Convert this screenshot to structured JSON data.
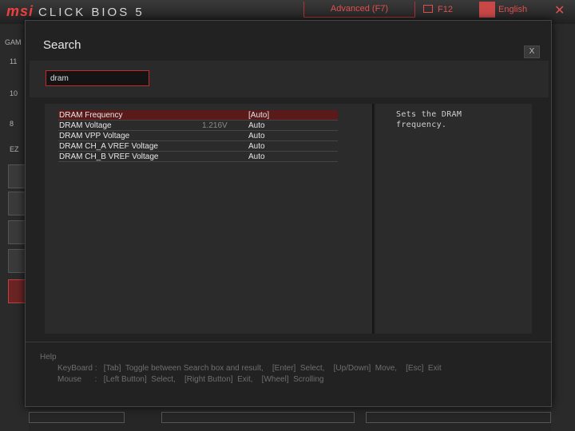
{
  "header": {
    "logo_brand": "msi",
    "logo_product": "CLICK BIOS 5",
    "advanced_label": "Advanced (F7)",
    "f12_label": "F12",
    "language_label": "English",
    "close_glyph": "✕",
    "accent_color": "#e05050"
  },
  "background": {
    "left_labels": [
      "GAM",
      "11",
      "10",
      "8",
      "EZ"
    ]
  },
  "dialog": {
    "title": "Search",
    "close_label": "X",
    "search": {
      "value": "dram",
      "placeholder": ""
    },
    "results": [
      {
        "name": "DRAM Frequency",
        "current": "",
        "value": "[Auto]",
        "selected": true
      },
      {
        "name": "DRAM Voltage",
        "current": "1.216V",
        "value": "Auto",
        "selected": false
      },
      {
        "name": "DRAM VPP Voltage",
        "current": "",
        "value": "Auto",
        "selected": false
      },
      {
        "name": "DRAM CH_A VREF Voltage",
        "current": "",
        "value": "Auto",
        "selected": false
      },
      {
        "name": "DRAM CH_B VREF Voltage",
        "current": "",
        "value": "Auto",
        "selected": false
      }
    ],
    "description": "Sets the DRAM frequency.",
    "help": {
      "title": "Help",
      "keyboard": "KeyBoard :   [Tab]  Toggle between Search box and result,    [Enter]  Select,    [Up/Down]  Move,    [Esc]  Exit",
      "mouse": "Mouse      :   [Left Button]  Select,    [Right Button]  Exit,    [Wheel]  Scrolling"
    },
    "selection_color": "#5a1a1a",
    "input_border_color": "#c22a2a"
  }
}
